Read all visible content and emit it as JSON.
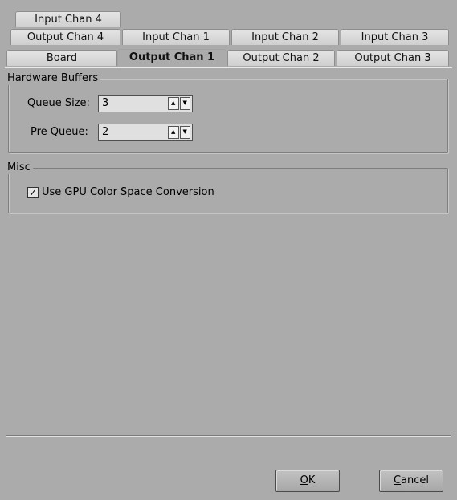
{
  "tabs": {
    "row3": [
      "Input Chan 4"
    ],
    "row2": [
      "Output Chan 4",
      "Input Chan 1",
      "Input Chan 2",
      "Input Chan 3"
    ],
    "row1": [
      "Board",
      "Output Chan 1",
      "Output Chan 2",
      "Output Chan 3"
    ],
    "active": "Output Chan 1"
  },
  "hardware_buffers": {
    "title": "Hardware Buffers",
    "queue_size_label": "Queue Size:",
    "queue_size_value": "3",
    "pre_queue_label": "Pre Queue:",
    "pre_queue_value": "2"
  },
  "misc": {
    "title": "Misc",
    "gpu_color_label": "Use GPU Color Space Conversion",
    "gpu_color_checked": true
  },
  "buttons": {
    "ok_mnemonic": "O",
    "ok_rest": "K",
    "cancel_mnemonic": "C",
    "cancel_rest": "ancel"
  }
}
